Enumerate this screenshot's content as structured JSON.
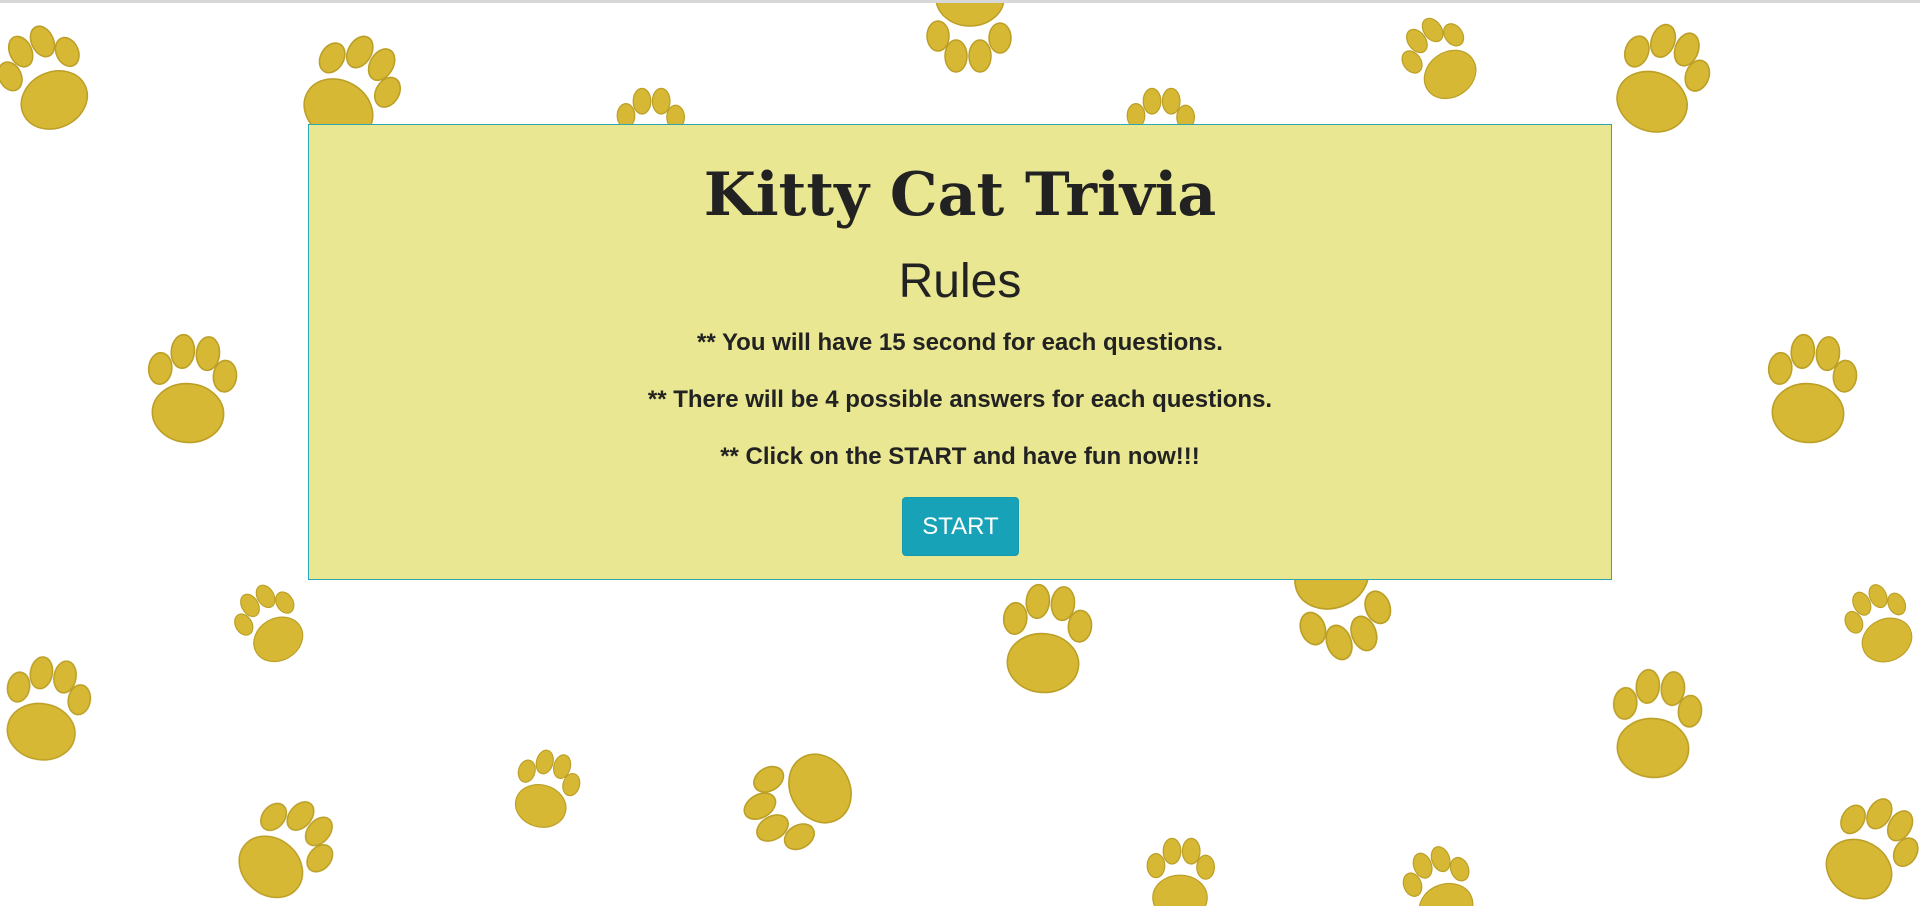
{
  "page": {
    "title": "Kitty Cat Trivia",
    "subtitle": "Rules",
    "rules": [
      "** You will have 15 second for each questions.",
      "** There will be 4 possible answers for each questions.",
      "** Click on the START and have fun now!!!"
    ],
    "start_label": "START"
  },
  "background": {
    "pattern": "paw-print-icon",
    "paw_color": "#d4b52a",
    "page_color": "#ffffff"
  },
  "colors": {
    "panel": "#e9e792",
    "panel_border": "#2fa7b3",
    "button": "#17a2b8",
    "text": "#222222"
  }
}
